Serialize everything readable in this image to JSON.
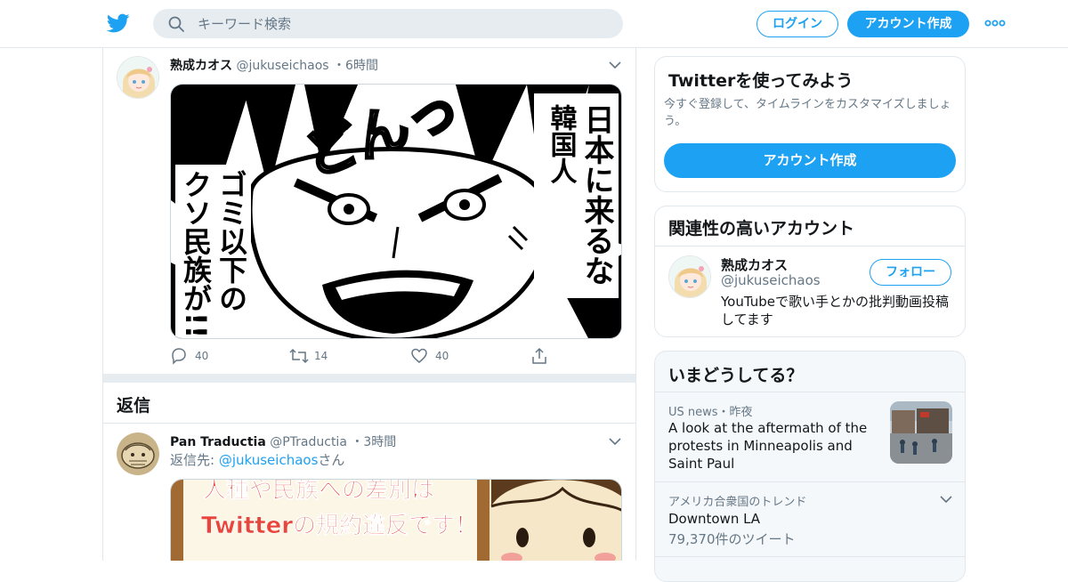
{
  "header": {
    "search_placeholder": "キーワード検索",
    "login_label": "ログイン",
    "signup_label": "アカウント作成"
  },
  "tweets": [
    {
      "name": "熟成カオス",
      "handle": "@jukuseichaos",
      "separator": "・",
      "time": "6時間",
      "image_text": {
        "right_line_1": "日本に来るな",
        "right_line_2": "韓国人",
        "left_line_1": "ゴミ以下の",
        "left_line_2": "クソ民族が!!",
        "sfx": "どんっ"
      },
      "reply_count": "40",
      "retweet_count": "14",
      "like_count": "40"
    },
    {
      "name": "Pan Traductia",
      "handle": "@PTraductia",
      "separator": "・",
      "time": "3時間",
      "reply_prefix": "返信先: ",
      "reply_mention": "@jukuseichaos",
      "reply_suffix": "さん",
      "image_text": {
        "line_1": "人種や民族への差別は",
        "line_2": "Twitterの規約違反です！"
      }
    }
  ],
  "replies_heading": "返信",
  "sidebar": {
    "promo": {
      "title": "Twitterを使ってみよう",
      "subtitle": "今すぐ登録して、タイムラインをカスタマイズしましょう。",
      "button": "アカウント作成"
    },
    "related": {
      "title": "関連性の高いアカウント",
      "name": "熟成カオス",
      "handle": "@jukuseichaos",
      "bio": "YouTubeで歌い手とかの批判動画投稿してます",
      "follow": "フォロー"
    },
    "trends": {
      "title": "いまどうしてる？",
      "items": [
        {
          "meta": "US news・昨夜",
          "title": "A look at the aftermath of the protests in Minneapolis and Saint Paul"
        },
        {
          "meta": "アメリカ合衆国のトレンド",
          "title": "Downtown LA",
          "count": "79,370件のツイート"
        }
      ]
    }
  },
  "colors": {
    "accent": "#1da1f2",
    "text": "#14171a",
    "secondary": "#657786",
    "border": "#e1e8ed",
    "search_bg": "#e6ecf0"
  },
  "icons": [
    "twitter-bird-icon",
    "search-icon",
    "more-dots-icon",
    "chevron-down-icon",
    "reply-icon",
    "retweet-icon",
    "like-icon",
    "share-icon"
  ]
}
